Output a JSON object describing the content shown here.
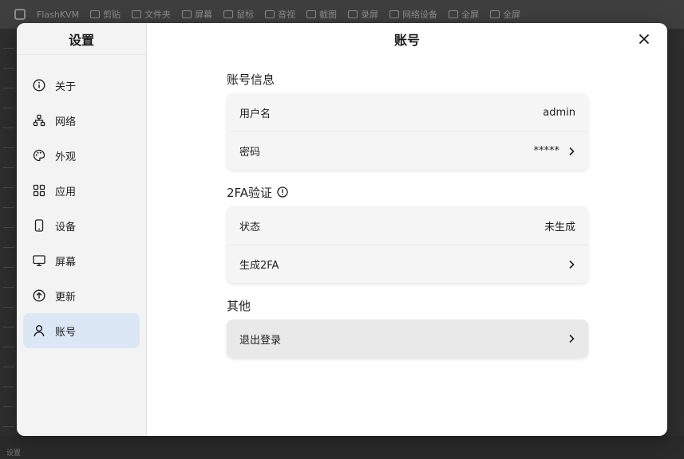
{
  "background": {
    "app_name": "FlashKVM",
    "toolbar_labels": [
      "剪贴",
      "文件夹",
      "屏幕",
      "鼠标",
      "音视",
      "截图",
      "录屏",
      "网络设备",
      "全屏",
      "全屏"
    ],
    "bottom_label": "设置"
  },
  "sidebar": {
    "title": "设置",
    "items": [
      {
        "label": "关于",
        "icon": "info-circle-icon"
      },
      {
        "label": "网络",
        "icon": "network-icon"
      },
      {
        "label": "外观",
        "icon": "palette-icon"
      },
      {
        "label": "应用",
        "icon": "apps-grid-icon"
      },
      {
        "label": "设备",
        "icon": "phone-device-icon"
      },
      {
        "label": "屏幕",
        "icon": "monitor-icon"
      },
      {
        "label": "更新",
        "icon": "update-arrow-icon"
      },
      {
        "label": "账号",
        "icon": "user-icon",
        "active": true
      }
    ]
  },
  "main": {
    "title": "账号",
    "sections": {
      "account_info": {
        "title": "账号信息",
        "username_label": "用户名",
        "username_value": "admin",
        "password_label": "密码",
        "password_value": "*****"
      },
      "twofa": {
        "title": "2FA验证",
        "status_label": "状态",
        "status_value": "未生成",
        "generate_label": "生成2FA"
      },
      "other": {
        "title": "其他",
        "logout_label": "退出登录"
      }
    }
  },
  "colors": {
    "active_nav_bg": "#dce7f6",
    "card_bg": "#f5f5f5",
    "sidebar_bg": "#f3f3f3"
  }
}
